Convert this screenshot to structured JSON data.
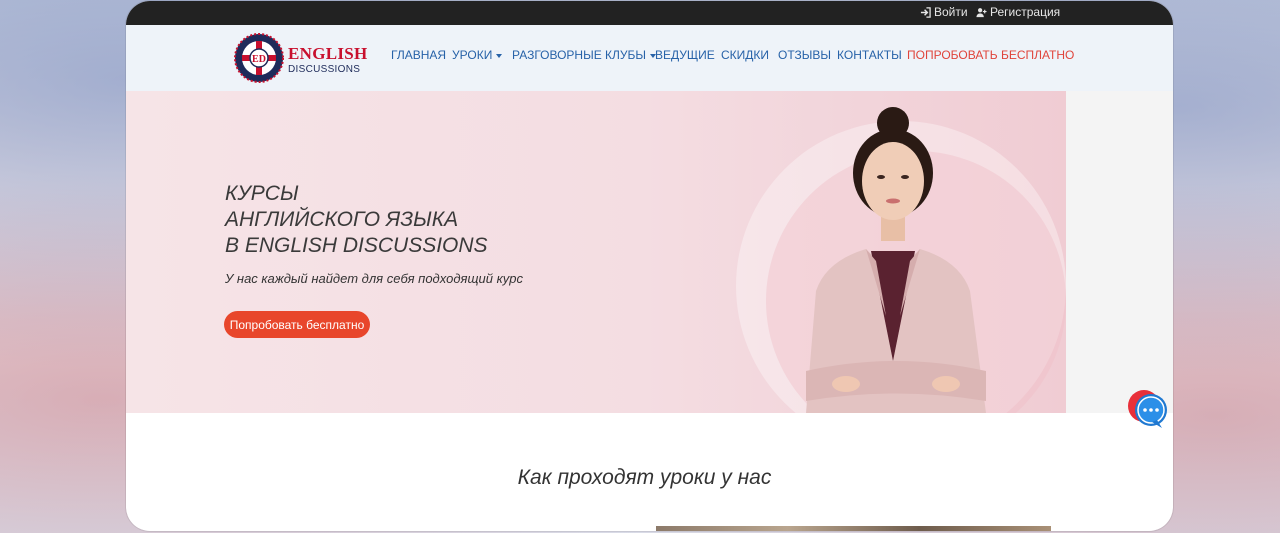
{
  "topbar": {
    "login_label": "Войти",
    "register_label": "Регистрация"
  },
  "logo": {
    "badge_text": "ED",
    "brand_line1": "ENGLISH",
    "brand_line2": "DISCUSSIONS"
  },
  "nav": {
    "items": [
      {
        "label": "ГЛАВНАЯ"
      },
      {
        "label": "УРОКИ"
      },
      {
        "label": "РАЗГОВОРНЫЕ КЛУБЫ"
      },
      {
        "label": "ВЕДУЩИЕ"
      },
      {
        "label": "СКИДКИ"
      },
      {
        "label": "ОТЗЫВЫ"
      },
      {
        "label": "КОНТАКТЫ"
      },
      {
        "label": "ПОПРОБОВАТЬ БЕСПЛАТНО"
      }
    ]
  },
  "hero": {
    "title_line1": "КУРСЫ",
    "title_line2": "АНГЛИЙСКОГО ЯЗЫКА",
    "title_line3": "В ENGLISH DISCUSSIONS",
    "subtitle": "У нас каждый найдет для себя подходящий курс",
    "cta_label": "Попробовать бесплатно"
  },
  "section": {
    "title": "Как проходят уроки у нас"
  },
  "colors": {
    "accent_red": "#e8462b",
    "nav_blue": "#2762a8",
    "topbar_bg": "#222222",
    "hero_bg": "#f6e4e7"
  },
  "icons": [
    "login-icon",
    "user-plus-icon",
    "chevron-down-icon",
    "chat-bubble-icon"
  ]
}
